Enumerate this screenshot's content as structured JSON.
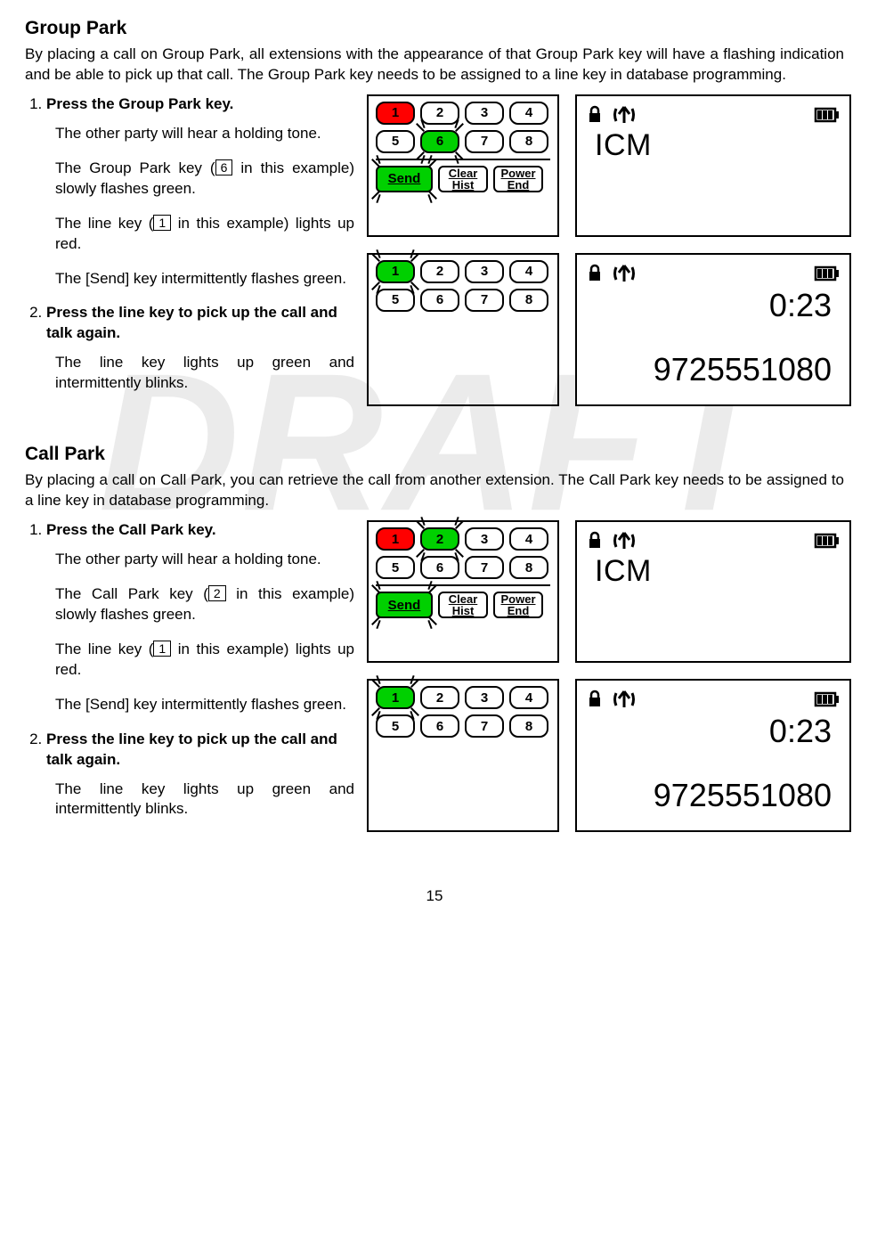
{
  "page_number": "15",
  "watermark": "DRAFT",
  "groupPark": {
    "title": "Group Park",
    "intro": "By placing a call on Group Park, all extensions with the appearance of that Group Park key will have a flashing indication and be able to pick up that call. The Group Park key needs to be assigned to a line key in database programming.",
    "step1_head": "Press the Group Park key.",
    "step1_b1": "The other party will  hear a holding tone.",
    "step1_b2a": "The Group Park key (",
    "step1_b2_key": "6",
    "step1_b2b": " in this example) slowly flashes green.",
    "step1_b3a": "The line key (",
    "step1_b3_key": "1",
    "step1_b3b": " in this example) lights up red.",
    "step1_b4": "The [Send] key intermittently flashes green.",
    "step2_head": "Press the line key to pick up the call and talk again.",
    "step2_b1": "The line key lights up green and intermittently blinks."
  },
  "callPark": {
    "title": "Call Park",
    "intro": "By placing a call on Call Park, you can retrieve the call from another extension. The Call Park key needs to be assigned to a line key in database programming.",
    "step1_head": "Press the Call Park key.",
    "step1_b1": "The other party will hear a holding tone.",
    "step1_b2a": "The Call Park key (",
    "step1_b2_key": "2",
    "step1_b2b": " in this example) slowly flashes green.",
    "step1_b3a": "The line key (",
    "step1_b3_key": "1",
    "step1_b3b": " in this example) lights up red.",
    "step1_b4": "The [Send] key intermittently flashes green.",
    "step2_head": "Press the line key to pick up the call and talk again.",
    "step2_b1": "The line key lights up green and intermittently blinks."
  },
  "keypad": {
    "k1": "1",
    "k2": "2",
    "k3": "3",
    "k4": "4",
    "k5": "5",
    "k6": "6",
    "k7": "7",
    "k8": "8",
    "send": "Send",
    "clear1": "Clear",
    "clear2": "Hist",
    "power1": "Power",
    "power2": "End"
  },
  "screen": {
    "icm": "ICM",
    "timer": "0:23",
    "number": "9725551080"
  },
  "chart_data": {
    "type": "table",
    "title": "Phone feature instructions with keypad/screen diagrams",
    "sections": [
      {
        "name": "Group Park",
        "step_1": {
          "key_red": 1,
          "key_green_flashing": 6,
          "send_flashing": true,
          "screen": "ICM"
        },
        "step_2": {
          "key_green_flashing": 1,
          "screen_timer": "0:23",
          "screen_number": "9725551080"
        }
      },
      {
        "name": "Call Park",
        "step_1": {
          "key_red": 1,
          "key_green_flashing": 2,
          "send_flashing": true,
          "screen": "ICM"
        },
        "step_2": {
          "key_green_flashing": 1,
          "screen_timer": "0:23",
          "screen_number": "9725551080"
        }
      }
    ]
  }
}
